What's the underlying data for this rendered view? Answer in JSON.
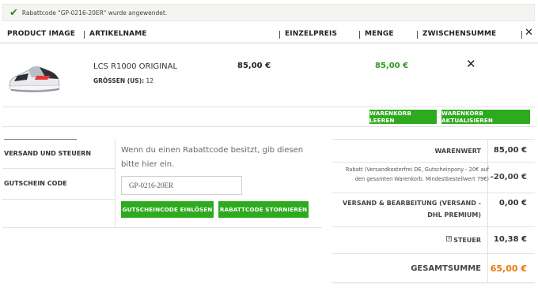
{
  "notice": {
    "icon": "checkmark-icon",
    "message": "Rabattcode \"GP-0216-20ER\" wurde angewendet."
  },
  "table_header": {
    "product_image": "PRODUCT IMAGE",
    "article_name": "ARTIKELNAME",
    "unit_price": "EINZELPREIS",
    "quantity": "MENGE",
    "subtotal": "ZWISCHENSUMME",
    "remove_all": "✕"
  },
  "product": {
    "image": "sneaker-image",
    "name": "LCS R1000 ORIGINAL",
    "size_label": "GRÖSSEN (US):",
    "size_value": "12",
    "unit_price": "85,00 €",
    "subtotal": "85,00 €",
    "remove": "✕"
  },
  "cart_actions": {
    "clear": "WARENKORB LEEREN",
    "update": "WARENKORB AKTUALISIEREN"
  },
  "tabs": {
    "shipping": "VERSAND UND STEUERN",
    "coupon": "GUTSCHEIN CODE"
  },
  "coupon_panel": {
    "info": "Wenn du einen Rabattcode besitzt, gib diesen bitte hier ein.",
    "code_value": "GP-0216-20ER",
    "redeem": "GUTSCHEINCODE EINLÖSEN",
    "cancel": "RABATTCODE STORNIEREN"
  },
  "totals": {
    "goods_label": "WARENWERT",
    "goods_value": "85,00 €",
    "discount_label": "Rabatt (Versandkosterfrei DE, Gutscheinpony - 20€ auf den gesamten Warenkorb. Mindestbestellwert 79€)",
    "discount_value": "-20,00 €",
    "shipping_label": "VERSAND & BEARBEITUNG (VERSAND - DHL PREMIUM)",
    "shipping_value": "0,00 €",
    "tax_label": "STEUER",
    "tax_value": "10,38 €",
    "grand_label": "GESAMTSUMME",
    "grand_value": "65,00 €"
  },
  "colors": {
    "accent_green": "#2eaa1e",
    "price_green": "#2e9a1e",
    "grand_total_orange": "#e8780c"
  }
}
